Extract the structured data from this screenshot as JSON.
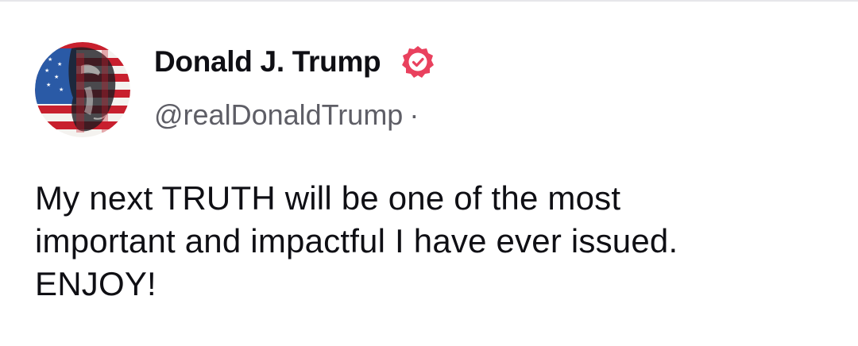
{
  "author": {
    "display_name": "Donald J. Trump",
    "handle": "@realDonaldTrump",
    "separator": "·",
    "verified": true
  },
  "post": {
    "lines": [
      "My next TRUTH will be one of the most",
      "important and impactful I have ever issued.",
      "ENJOY!"
    ]
  },
  "colors": {
    "badge": "#e9415e",
    "text": "#0f0f14",
    "muted": "#5e5e66"
  }
}
